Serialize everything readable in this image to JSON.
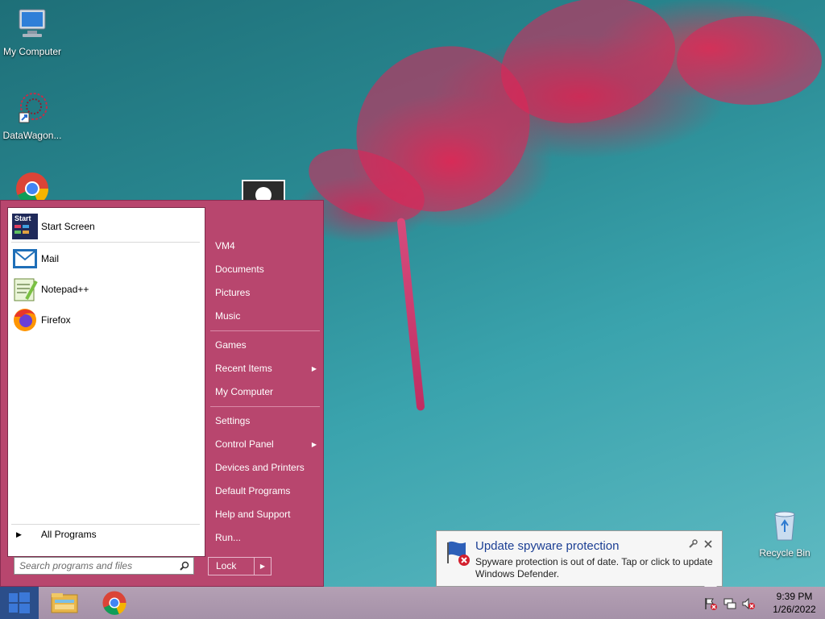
{
  "desktop": {
    "icons": [
      {
        "label": "My Computer"
      },
      {
        "label": "DataWagon..."
      },
      {
        "label": "Recycle Bin"
      }
    ]
  },
  "start_menu": {
    "programs": [
      {
        "label": "Start Screen",
        "icon_text": "Start"
      },
      {
        "label": "Mail"
      },
      {
        "label": "Notepad++"
      },
      {
        "label": "Firefox"
      }
    ],
    "all_programs": "All Programs",
    "search_placeholder": "Search programs and files",
    "right_items": [
      {
        "label": "VM4"
      },
      {
        "label": "Documents"
      },
      {
        "label": "Pictures"
      },
      {
        "label": "Music"
      },
      {
        "label": "Games"
      },
      {
        "label": "Recent Items"
      },
      {
        "label": "My Computer"
      },
      {
        "label": "Settings"
      },
      {
        "label": "Control Panel"
      },
      {
        "label": "Devices and Printers"
      },
      {
        "label": "Default Programs"
      },
      {
        "label": "Help and Support"
      },
      {
        "label": "Run..."
      }
    ],
    "lock_label": "Lock"
  },
  "notification": {
    "title": "Update spyware protection",
    "body": "Spyware protection is out of date. Tap or click to update Windows Defender."
  },
  "taskbar": {
    "time": "9:39 PM",
    "date": "1/26/2022"
  },
  "colors": {
    "start_menu_bg": "#b8466e",
    "balloon_title": "#1c3f94"
  }
}
